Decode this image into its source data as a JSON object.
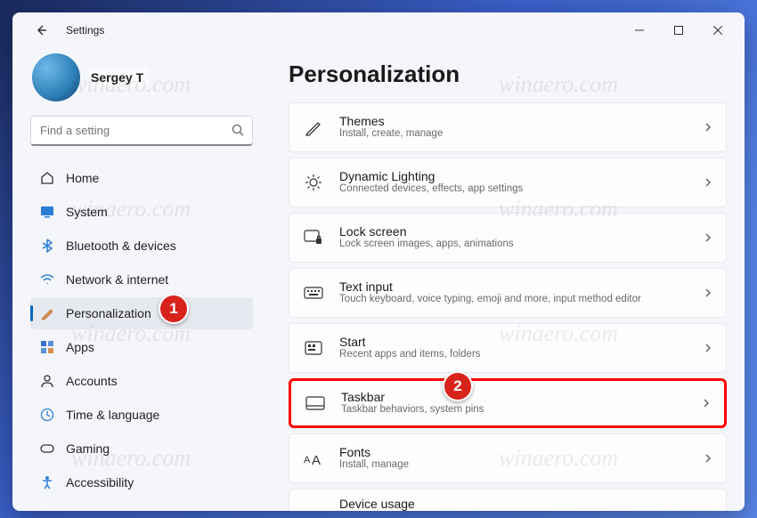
{
  "window": {
    "title": "Settings"
  },
  "user": {
    "name": "Sergey T"
  },
  "search": {
    "placeholder": "Find a setting"
  },
  "nav": [
    {
      "label": "Home"
    },
    {
      "label": "System"
    },
    {
      "label": "Bluetooth & devices"
    },
    {
      "label": "Network & internet"
    },
    {
      "label": "Personalization"
    },
    {
      "label": "Apps"
    },
    {
      "label": "Accounts"
    },
    {
      "label": "Time & language"
    },
    {
      "label": "Gaming"
    },
    {
      "label": "Accessibility"
    }
  ],
  "page": {
    "title": "Personalization"
  },
  "cards": [
    {
      "title": "Themes",
      "sub": "Install, create, manage"
    },
    {
      "title": "Dynamic Lighting",
      "sub": "Connected devices, effects, app settings"
    },
    {
      "title": "Lock screen",
      "sub": "Lock screen images, apps, animations"
    },
    {
      "title": "Text input",
      "sub": "Touch keyboard, voice typing, emoji and more, input method editor"
    },
    {
      "title": "Start",
      "sub": "Recent apps and items, folders"
    },
    {
      "title": "Taskbar",
      "sub": "Taskbar behaviors, system pins"
    },
    {
      "title": "Fonts",
      "sub": "Install, manage"
    },
    {
      "title": "Device usage",
      "sub": ""
    }
  ],
  "callouts": {
    "one": "1",
    "two": "2"
  },
  "watermark": "winaero.com"
}
